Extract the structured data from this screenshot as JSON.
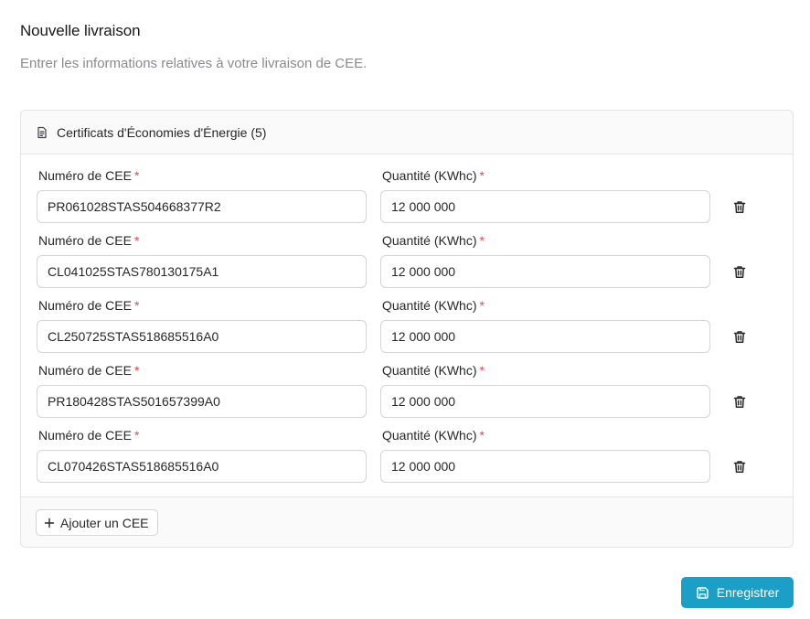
{
  "header": {
    "title": "Nouvelle livraison",
    "subtitle": "Entrer les informations relatives à votre livraison de CEE."
  },
  "card": {
    "title": "Certificats d'Économies d'Énergie (5)",
    "icon": "document-icon"
  },
  "labels": {
    "cee": "Numéro de CEE",
    "quantity": "Quantité (KWhc)",
    "required_marker": "*"
  },
  "rows": [
    {
      "cee": "PR061028STAS504668377R2",
      "quantity": "12 000 000"
    },
    {
      "cee": "CL041025STAS780130175A1",
      "quantity": "12 000 000"
    },
    {
      "cee": "CL250725STAS518685516A0",
      "quantity": "12 000 000"
    },
    {
      "cee": "PR180428STAS501657399A0",
      "quantity": "12 000 000"
    },
    {
      "cee": "CL070426STAS518685516A0",
      "quantity": "12 000 000"
    }
  ],
  "actions": {
    "add_label": "Ajouter un CEE",
    "save_label": "Enregistrer"
  },
  "colors": {
    "primary": "#1b9fc6",
    "required": "#ef4444"
  }
}
